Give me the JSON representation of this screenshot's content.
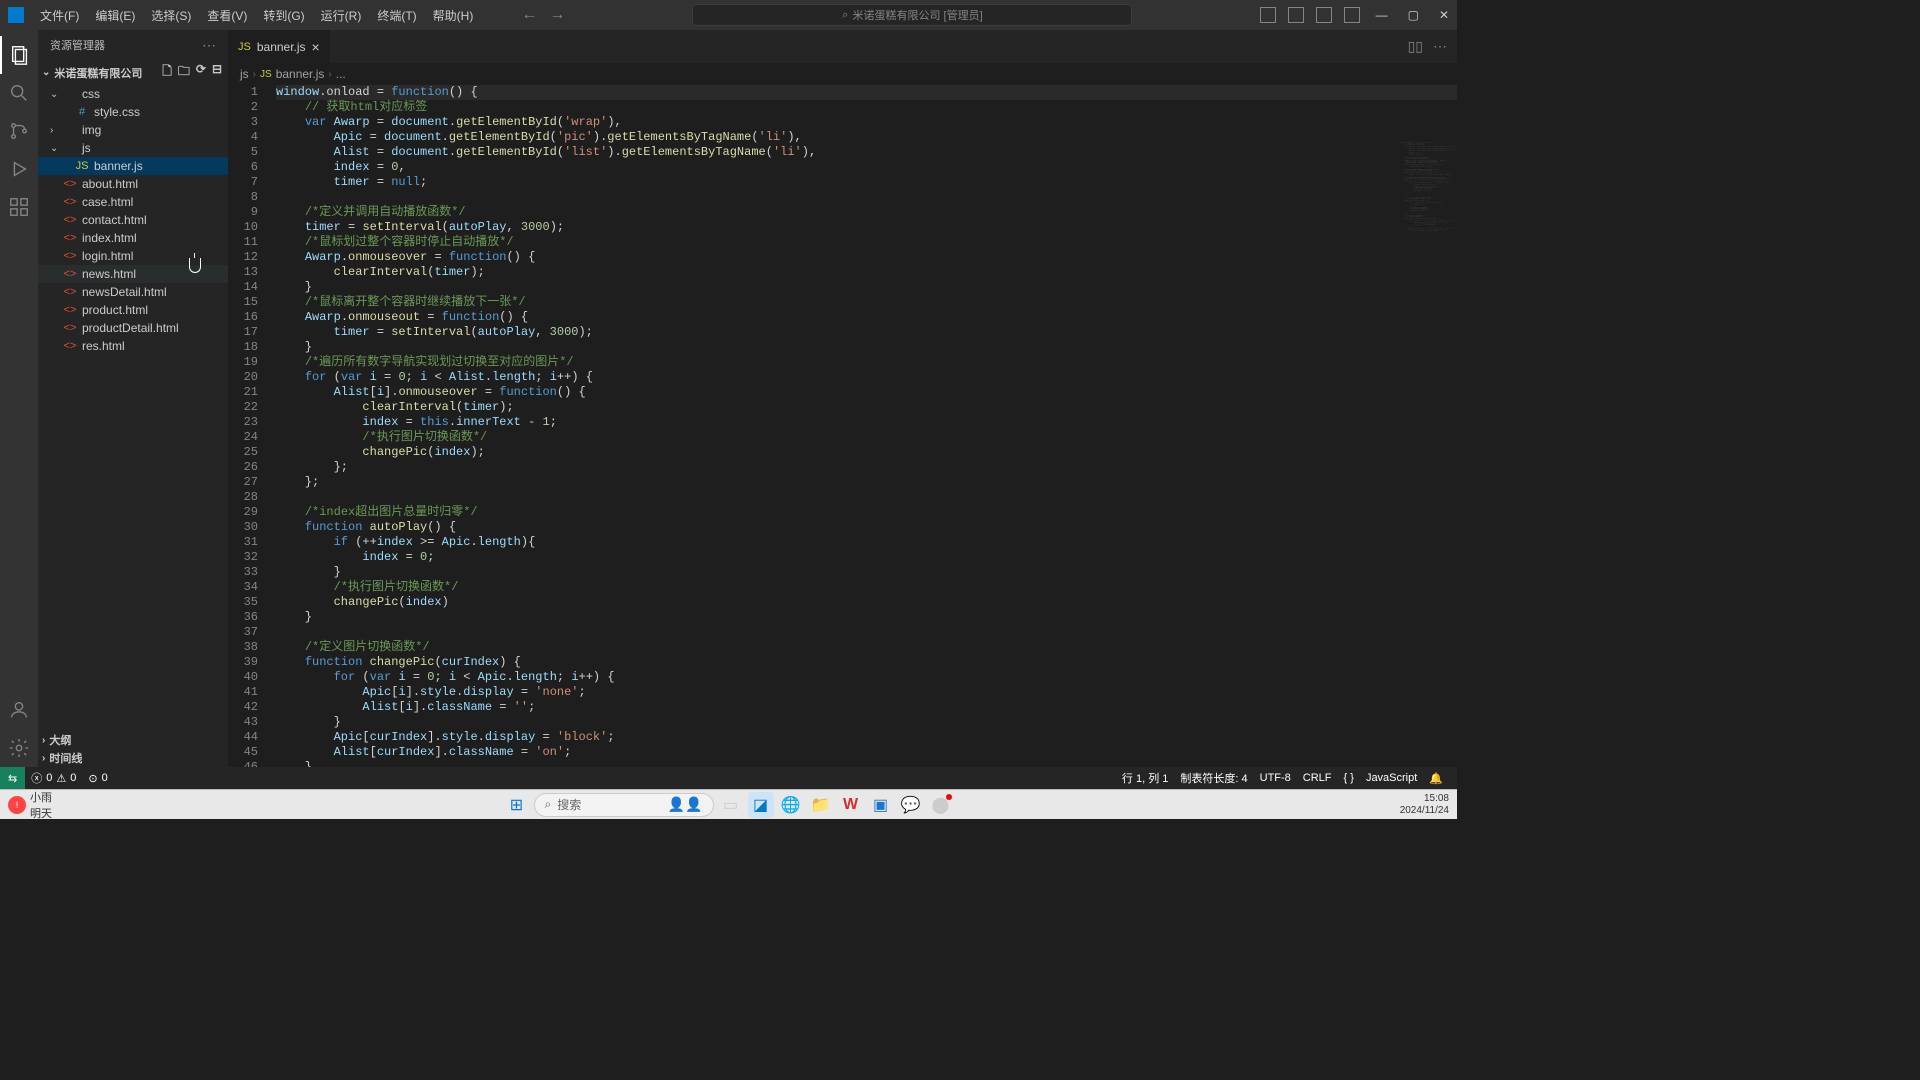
{
  "titlebar": {
    "menus": [
      "文件(F)",
      "编辑(E)",
      "选择(S)",
      "查看(V)",
      "转到(G)",
      "运行(R)",
      "终端(T)",
      "帮助(H)"
    ],
    "search_text": "米诺蛋糕有限公司 [管理员]"
  },
  "sidebar": {
    "title": "资源管理器",
    "root": "米诺蛋糕有限公司",
    "tree": [
      {
        "type": "folder",
        "name": "css",
        "depth": 1,
        "expanded": true
      },
      {
        "type": "file",
        "name": "style.css",
        "depth": 2,
        "icon": "css",
        "sym": "#"
      },
      {
        "type": "folder",
        "name": "img",
        "depth": 1,
        "expanded": false
      },
      {
        "type": "folder",
        "name": "js",
        "depth": 1,
        "expanded": true
      },
      {
        "type": "file",
        "name": "banner.js",
        "depth": 2,
        "icon": "js",
        "sym": "JS",
        "selected": true
      },
      {
        "type": "file",
        "name": "about.html",
        "depth": 1,
        "icon": "html",
        "sym": "<>"
      },
      {
        "type": "file",
        "name": "case.html",
        "depth": 1,
        "icon": "html",
        "sym": "<>"
      },
      {
        "type": "file",
        "name": "contact.html",
        "depth": 1,
        "icon": "html",
        "sym": "<>"
      },
      {
        "type": "file",
        "name": "index.html",
        "depth": 1,
        "icon": "html",
        "sym": "<>"
      },
      {
        "type": "file",
        "name": "login.html",
        "depth": 1,
        "icon": "html",
        "sym": "<>"
      },
      {
        "type": "file",
        "name": "news.html",
        "depth": 1,
        "icon": "html",
        "sym": "<>",
        "hovered": true
      },
      {
        "type": "file",
        "name": "newsDetail.html",
        "depth": 1,
        "icon": "html",
        "sym": "<>"
      },
      {
        "type": "file",
        "name": "product.html",
        "depth": 1,
        "icon": "html",
        "sym": "<>"
      },
      {
        "type": "file",
        "name": "productDetail.html",
        "depth": 1,
        "icon": "html",
        "sym": "<>"
      },
      {
        "type": "file",
        "name": "res.html",
        "depth": 1,
        "icon": "html",
        "sym": "<>"
      }
    ],
    "outline": "大纲",
    "timeline": "时间线"
  },
  "tab": {
    "icon": "JS",
    "label": "banner.js"
  },
  "breadcrumb": [
    "js",
    "banner.js",
    "..."
  ],
  "code_lines": [
    [
      [
        "var",
        "window"
      ],
      [
        "op",
        ".onload "
      ],
      [
        "op",
        "= "
      ],
      [
        "kw",
        "function"
      ],
      [
        "op",
        "() {"
      ]
    ],
    [
      [
        "op",
        "    "
      ],
      [
        "com",
        "// 获取html对应标签"
      ]
    ],
    [
      [
        "op",
        "    "
      ],
      [
        "kw",
        "var"
      ],
      [
        "op",
        " "
      ],
      [
        "var",
        "Awarp"
      ],
      [
        "op",
        " = "
      ],
      [
        "var",
        "document"
      ],
      [
        "op",
        "."
      ],
      [
        "fn",
        "getElementById"
      ],
      [
        "op",
        "("
      ],
      [
        "str",
        "'wrap'"
      ],
      [
        "op",
        "),"
      ]
    ],
    [
      [
        "op",
        "        "
      ],
      [
        "var",
        "Apic"
      ],
      [
        "op",
        " = "
      ],
      [
        "var",
        "document"
      ],
      [
        "op",
        "."
      ],
      [
        "fn",
        "getElementById"
      ],
      [
        "op",
        "("
      ],
      [
        "str",
        "'pic'"
      ],
      [
        "op",
        ")."
      ],
      [
        "fn",
        "getElementsByTagName"
      ],
      [
        "op",
        "("
      ],
      [
        "str",
        "'li'"
      ],
      [
        "op",
        "),"
      ]
    ],
    [
      [
        "op",
        "        "
      ],
      [
        "var",
        "Alist"
      ],
      [
        "op",
        " = "
      ],
      [
        "var",
        "document"
      ],
      [
        "op",
        "."
      ],
      [
        "fn",
        "getElementById"
      ],
      [
        "op",
        "("
      ],
      [
        "str",
        "'list'"
      ],
      [
        "op",
        ")."
      ],
      [
        "fn",
        "getElementsByTagName"
      ],
      [
        "op",
        "("
      ],
      [
        "str",
        "'li'"
      ],
      [
        "op",
        "),"
      ]
    ],
    [
      [
        "op",
        "        "
      ],
      [
        "var",
        "index"
      ],
      [
        "op",
        " = "
      ],
      [
        "num",
        "0"
      ],
      [
        "op",
        ","
      ]
    ],
    [
      [
        "op",
        "        "
      ],
      [
        "var",
        "timer"
      ],
      [
        "op",
        " = "
      ],
      [
        "null",
        "null"
      ],
      [
        "op",
        ";"
      ]
    ],
    [
      [
        "op",
        ""
      ]
    ],
    [
      [
        "op",
        "    "
      ],
      [
        "com",
        "/*定义并调用自动播放函数*/"
      ]
    ],
    [
      [
        "op",
        "    "
      ],
      [
        "var",
        "timer"
      ],
      [
        "op",
        " = "
      ],
      [
        "fn",
        "setInterval"
      ],
      [
        "op",
        "("
      ],
      [
        "var",
        "autoPlay"
      ],
      [
        "op",
        ", "
      ],
      [
        "num",
        "3000"
      ],
      [
        "op",
        ");"
      ]
    ],
    [
      [
        "op",
        "    "
      ],
      [
        "com",
        "/*鼠标划过整个容器时停止自动播放*/"
      ]
    ],
    [
      [
        "op",
        "    "
      ],
      [
        "var",
        "Awarp"
      ],
      [
        "op",
        "."
      ],
      [
        "fn",
        "onmouseover"
      ],
      [
        "op",
        " = "
      ],
      [
        "kw",
        "function"
      ],
      [
        "op",
        "() {"
      ]
    ],
    [
      [
        "op",
        "        "
      ],
      [
        "fn",
        "clearInterval"
      ],
      [
        "op",
        "("
      ],
      [
        "var",
        "timer"
      ],
      [
        "op",
        ");"
      ]
    ],
    [
      [
        "op",
        "    }"
      ]
    ],
    [
      [
        "op",
        "    "
      ],
      [
        "com",
        "/*鼠标离开整个容器时继续播放下一张*/"
      ]
    ],
    [
      [
        "op",
        "    "
      ],
      [
        "var",
        "Awarp"
      ],
      [
        "op",
        "."
      ],
      [
        "fn",
        "onmouseout"
      ],
      [
        "op",
        " = "
      ],
      [
        "kw",
        "function"
      ],
      [
        "op",
        "() {"
      ]
    ],
    [
      [
        "op",
        "        "
      ],
      [
        "var",
        "timer"
      ],
      [
        "op",
        " = "
      ],
      [
        "fn",
        "setInterval"
      ],
      [
        "op",
        "("
      ],
      [
        "var",
        "autoPlay"
      ],
      [
        "op",
        ", "
      ],
      [
        "num",
        "3000"
      ],
      [
        "op",
        ");"
      ]
    ],
    [
      [
        "op",
        "    }"
      ]
    ],
    [
      [
        "op",
        "    "
      ],
      [
        "com",
        "/*遍历所有数字导航实现划过切换至对应的图片*/"
      ]
    ],
    [
      [
        "op",
        "    "
      ],
      [
        "kw",
        "for"
      ],
      [
        "op",
        " ("
      ],
      [
        "kw",
        "var"
      ],
      [
        "op",
        " "
      ],
      [
        "var",
        "i"
      ],
      [
        "op",
        " = "
      ],
      [
        "num",
        "0"
      ],
      [
        "op",
        "; "
      ],
      [
        "var",
        "i"
      ],
      [
        "op",
        " < "
      ],
      [
        "var",
        "Alist"
      ],
      [
        "op",
        "."
      ],
      [
        "var",
        "length"
      ],
      [
        "op",
        "; "
      ],
      [
        "var",
        "i"
      ],
      [
        "op",
        "++) {"
      ]
    ],
    [
      [
        "op",
        "        "
      ],
      [
        "var",
        "Alist"
      ],
      [
        "op",
        "["
      ],
      [
        "var",
        "i"
      ],
      [
        "op",
        "]."
      ],
      [
        "fn",
        "onmouseover"
      ],
      [
        "op",
        " = "
      ],
      [
        "kw",
        "function"
      ],
      [
        "op",
        "() {"
      ]
    ],
    [
      [
        "op",
        "            "
      ],
      [
        "fn",
        "clearInterval"
      ],
      [
        "op",
        "("
      ],
      [
        "var",
        "timer"
      ],
      [
        "op",
        ");"
      ]
    ],
    [
      [
        "op",
        "            "
      ],
      [
        "var",
        "index"
      ],
      [
        "op",
        " = "
      ],
      [
        "kw",
        "this"
      ],
      [
        "op",
        "."
      ],
      [
        "var",
        "innerText"
      ],
      [
        "op",
        " - "
      ],
      [
        "num",
        "1"
      ],
      [
        "op",
        ";"
      ]
    ],
    [
      [
        "op",
        "            "
      ],
      [
        "com",
        "/*执行图片切换函数*/"
      ]
    ],
    [
      [
        "op",
        "            "
      ],
      [
        "fn",
        "changePic"
      ],
      [
        "op",
        "("
      ],
      [
        "var",
        "index"
      ],
      [
        "op",
        ");"
      ]
    ],
    [
      [
        "op",
        "        };"
      ]
    ],
    [
      [
        "op",
        "    };"
      ]
    ],
    [
      [
        "op",
        ""
      ]
    ],
    [
      [
        "op",
        "    "
      ],
      [
        "com",
        "/*index超出图片总量时归零*/"
      ]
    ],
    [
      [
        "op",
        "    "
      ],
      [
        "kw",
        "function"
      ],
      [
        "op",
        " "
      ],
      [
        "fn",
        "autoPlay"
      ],
      [
        "op",
        "() {"
      ]
    ],
    [
      [
        "op",
        "        "
      ],
      [
        "kw",
        "if"
      ],
      [
        "op",
        " (++"
      ],
      [
        "var",
        "index"
      ],
      [
        "op",
        " >= "
      ],
      [
        "var",
        "Apic"
      ],
      [
        "op",
        "."
      ],
      [
        "var",
        "length"
      ],
      [
        "op",
        "){"
      ]
    ],
    [
      [
        "op",
        "            "
      ],
      [
        "var",
        "index"
      ],
      [
        "op",
        " = "
      ],
      [
        "num",
        "0"
      ],
      [
        "op",
        ";"
      ]
    ],
    [
      [
        "op",
        "        }"
      ]
    ],
    [
      [
        "op",
        "        "
      ],
      [
        "com",
        "/*执行图片切换函数*/"
      ]
    ],
    [
      [
        "op",
        "        "
      ],
      [
        "fn",
        "changePic"
      ],
      [
        "op",
        "("
      ],
      [
        "var",
        "index"
      ],
      [
        "op",
        ")"
      ]
    ],
    [
      [
        "op",
        "    }"
      ]
    ],
    [
      [
        "op",
        ""
      ]
    ],
    [
      [
        "op",
        "    "
      ],
      [
        "com",
        "/*定义图片切换函数*/"
      ]
    ],
    [
      [
        "op",
        "    "
      ],
      [
        "kw",
        "function"
      ],
      [
        "op",
        " "
      ],
      [
        "fn",
        "changePic"
      ],
      [
        "op",
        "("
      ],
      [
        "var",
        "curIndex"
      ],
      [
        "op",
        ") {"
      ]
    ],
    [
      [
        "op",
        "        "
      ],
      [
        "kw",
        "for"
      ],
      [
        "op",
        " ("
      ],
      [
        "kw",
        "var"
      ],
      [
        "op",
        " "
      ],
      [
        "var",
        "i"
      ],
      [
        "op",
        " = "
      ],
      [
        "num",
        "0"
      ],
      [
        "op",
        "; "
      ],
      [
        "var",
        "i"
      ],
      [
        "op",
        " < "
      ],
      [
        "var",
        "Apic"
      ],
      [
        "op",
        "."
      ],
      [
        "var",
        "length"
      ],
      [
        "op",
        "; "
      ],
      [
        "var",
        "i"
      ],
      [
        "op",
        "++) {"
      ]
    ],
    [
      [
        "op",
        "            "
      ],
      [
        "var",
        "Apic"
      ],
      [
        "op",
        "["
      ],
      [
        "var",
        "i"
      ],
      [
        "op",
        "]."
      ],
      [
        "var",
        "style"
      ],
      [
        "op",
        "."
      ],
      [
        "var",
        "display"
      ],
      [
        "op",
        " = "
      ],
      [
        "str",
        "'none'"
      ],
      [
        "op",
        ";"
      ]
    ],
    [
      [
        "op",
        "            "
      ],
      [
        "var",
        "Alist"
      ],
      [
        "op",
        "["
      ],
      [
        "var",
        "i"
      ],
      [
        "op",
        "]."
      ],
      [
        "var",
        "className"
      ],
      [
        "op",
        " = "
      ],
      [
        "str",
        "''"
      ],
      [
        "op",
        ";"
      ]
    ],
    [
      [
        "op",
        "        }"
      ]
    ],
    [
      [
        "op",
        "        "
      ],
      [
        "var",
        "Apic"
      ],
      [
        "op",
        "["
      ],
      [
        "var",
        "curIndex"
      ],
      [
        "op",
        "]."
      ],
      [
        "var",
        "style"
      ],
      [
        "op",
        "."
      ],
      [
        "var",
        "display"
      ],
      [
        "op",
        " = "
      ],
      [
        "str",
        "'block'"
      ],
      [
        "op",
        ";"
      ]
    ],
    [
      [
        "op",
        "        "
      ],
      [
        "var",
        "Alist"
      ],
      [
        "op",
        "["
      ],
      [
        "var",
        "curIndex"
      ],
      [
        "op",
        "]."
      ],
      [
        "var",
        "className"
      ],
      [
        "op",
        " = "
      ],
      [
        "str",
        "'on'"
      ],
      [
        "op",
        ";"
      ]
    ],
    [
      [
        "op",
        "    }"
      ]
    ],
    [
      [
        "op",
        "}"
      ]
    ],
    [
      [
        "op",
        ""
      ]
    ]
  ],
  "statusbar": {
    "errors": "0",
    "warnings": "0",
    "ports": "0",
    "line_col": "行 1, 列 1",
    "tabsize": "制表符长度: 4",
    "encoding": "UTF-8",
    "eol": "CRLF",
    "lang": "JavaScript"
  },
  "taskbar": {
    "weather1": "小雨",
    "weather2": "明天",
    "search": "搜索",
    "time": "15:08",
    "date": "2024/11/24"
  }
}
